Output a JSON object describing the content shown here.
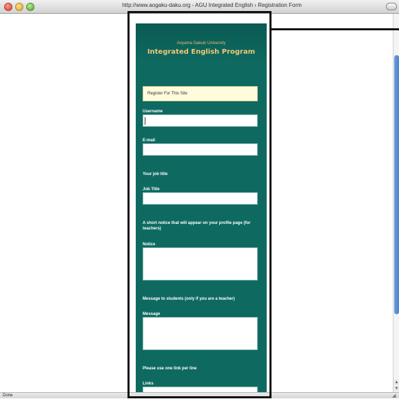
{
  "window": {
    "title": "http://www.aogaku-daku.org - AGU Integrated English › Registration Form"
  },
  "status": {
    "text": "Done"
  },
  "header": {
    "university": "Aoyama Gakuin University",
    "program": "Integrated English Program"
  },
  "form": {
    "intro": "Register For This Site",
    "username_label": "Username",
    "email_label": "E-mail",
    "job_section": "Your job title",
    "job_label": "Job Title",
    "notice_section": "A short notice that will appear on your profile page (for teachers)",
    "notice_label": "Notice",
    "message_section": "Message to students (only if you are a teacher)",
    "message_label": "Message",
    "links_section": "Please use one link per line",
    "links_label": "Links"
  },
  "colors": {
    "page_bg": "#0e6a61",
    "title_gold": "#f0c878",
    "notice_bg": "#fffbdc",
    "scroll_thumb": "#4c82cc"
  },
  "icons": {
    "close": "close-icon",
    "minimize": "minimize-icon",
    "maximize": "maximize-icon",
    "resize": "resize-grip-icon"
  }
}
